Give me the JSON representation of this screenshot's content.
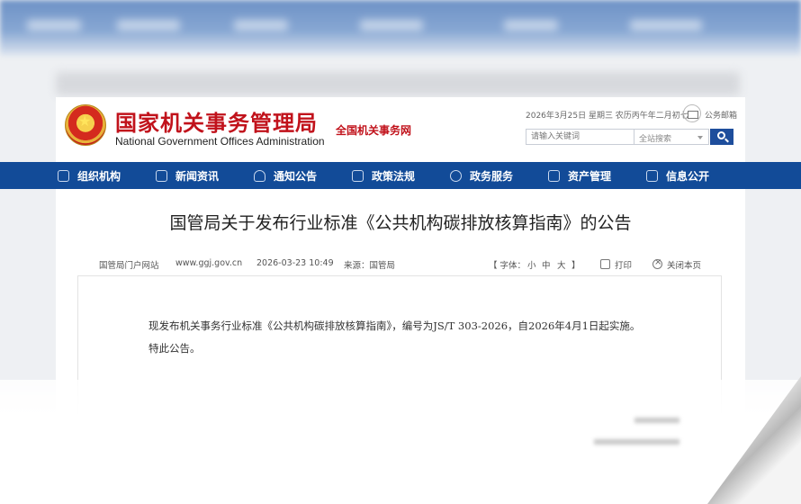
{
  "header": {
    "logo_cn": "国家机关事务管理局",
    "logo_en": "National Government Offices Administration",
    "site_tag": "全国机关事务网",
    "date_line": "2026年3月25日 星期三  农历丙午年二月初七",
    "mail_label": "公务邮箱",
    "search_placeholder": "请输入关键词",
    "search_scope": "全站搜索"
  },
  "nav": {
    "items": [
      {
        "label": "组织机构",
        "icon": "org-icon"
      },
      {
        "label": "新闻资讯",
        "icon": "news-icon"
      },
      {
        "label": "通知公告",
        "icon": "bell-icon"
      },
      {
        "label": "政策法规",
        "icon": "policy-icon"
      },
      {
        "label": "政务服务",
        "icon": "heart-icon"
      },
      {
        "label": "资产管理",
        "icon": "grid-icon"
      },
      {
        "label": "信息公开",
        "icon": "info-icon"
      }
    ]
  },
  "article": {
    "title": "国管局关于发布行业标准《公共机构碳排放核算指南》的公告",
    "meta_site": "国管局门户网站",
    "meta_url": "www.ggj.gov.cn",
    "meta_date": "2026-03-23 10:49",
    "meta_source": "来源：国管局",
    "font_label": "【 字体：",
    "font_small": "小",
    "font_medium": "中",
    "font_large": "大",
    "font_end": "】",
    "print_label": "打印",
    "close_label": "关闭本页",
    "paragraph_1": "现发布机关事务行业标准《公共机构碳排放核算指南》，编号为JS/T 303-2026，自2026年4月1日起实施。",
    "paragraph_2": "特此公告。"
  },
  "colors": {
    "nav_bg": "#124b98",
    "logo_red": "#c1121b",
    "search_button": "#1e4e9c"
  }
}
